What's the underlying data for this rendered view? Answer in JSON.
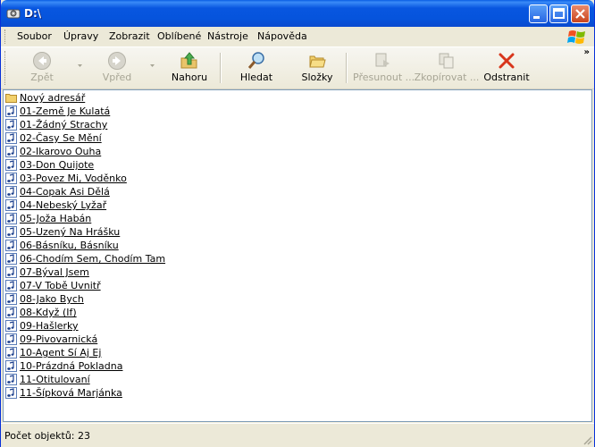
{
  "window": {
    "title": "D:\\"
  },
  "menu": [
    "Soubor",
    "Úpravy",
    "Zobrazit",
    "Oblíbené",
    "Nástroje",
    "Nápověda"
  ],
  "toolbar": {
    "back": "Zpět",
    "forward": "Vpřed",
    "up": "Nahoru",
    "search": "Hledat",
    "folders": "Složky",
    "move": "Přesunout ...",
    "copy": "Zkopírovat ...",
    "delete": "Odstranit"
  },
  "files": [
    {
      "name": "Nový adresář",
      "type": "folder"
    },
    {
      "name": "01-Země Je Kulatá",
      "type": "audio"
    },
    {
      "name": "01-Žádný Strachy",
      "type": "audio"
    },
    {
      "name": "02-Časy Se Mění",
      "type": "audio"
    },
    {
      "name": "02-Ikarovo Ouha",
      "type": "audio"
    },
    {
      "name": "03-Don Quijote",
      "type": "audio"
    },
    {
      "name": "03-Povez Mi, Voděnko",
      "type": "audio"
    },
    {
      "name": "04-Copak Asi Dělá",
      "type": "audio"
    },
    {
      "name": "04-Nebeský Lyžař",
      "type": "audio"
    },
    {
      "name": "05-Joža Habán",
      "type": "audio"
    },
    {
      "name": "05-Uzený Na Hrášku",
      "type": "audio"
    },
    {
      "name": "06-Básníku, Básníku",
      "type": "audio"
    },
    {
      "name": "06-Chodím Sem, Chodím Tam",
      "type": "audio"
    },
    {
      "name": "07-Býval Jsem",
      "type": "audio"
    },
    {
      "name": "07-V Tobě Uvnitř",
      "type": "audio"
    },
    {
      "name": "08-Jako Bych",
      "type": "audio"
    },
    {
      "name": "08-Když (If)",
      "type": "audio"
    },
    {
      "name": "09-Hašlerky",
      "type": "audio"
    },
    {
      "name": "09-Pivovarnická",
      "type": "audio"
    },
    {
      "name": "10-Agent Sí Aj Ej",
      "type": "audio"
    },
    {
      "name": "10-Prázdná Pokladna",
      "type": "audio"
    },
    {
      "name": "11-Otitulovaní",
      "type": "audio"
    },
    {
      "name": "11-Šípková Marjánka",
      "type": "audio"
    }
  ],
  "status": {
    "text": "Počet objektů: 23"
  },
  "colors": {
    "titlebar": "#0A5EE3",
    "chrome": "#ECE9D8",
    "delete_red": "#D8351B"
  }
}
